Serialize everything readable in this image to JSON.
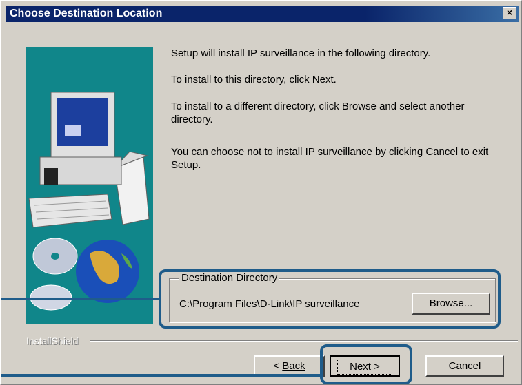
{
  "window": {
    "title": "Choose Destination Location",
    "close_label": "×"
  },
  "body_text": {
    "line1": "Setup will install IP surveillance in the following directory.",
    "line2": "To install to this directory, click Next.",
    "line3": "To install to a different directory, click Browse and select another directory.",
    "line4": "You can choose not to install IP surveillance by clicking Cancel to exit Setup."
  },
  "destination": {
    "group_label": "Destination Directory",
    "path": "C:\\Program Files\\D-Link\\IP surveillance",
    "browse_label": "Browse..."
  },
  "footer": {
    "brand": "InstallShield",
    "back_label": "Back",
    "next_label": "Next >",
    "cancel_label": "Cancel"
  },
  "colors": {
    "title_bar": "#0a246a",
    "dialog_bg": "#d4d0c8",
    "art_bg": "#10868a",
    "highlight": "#1f5c8a"
  }
}
